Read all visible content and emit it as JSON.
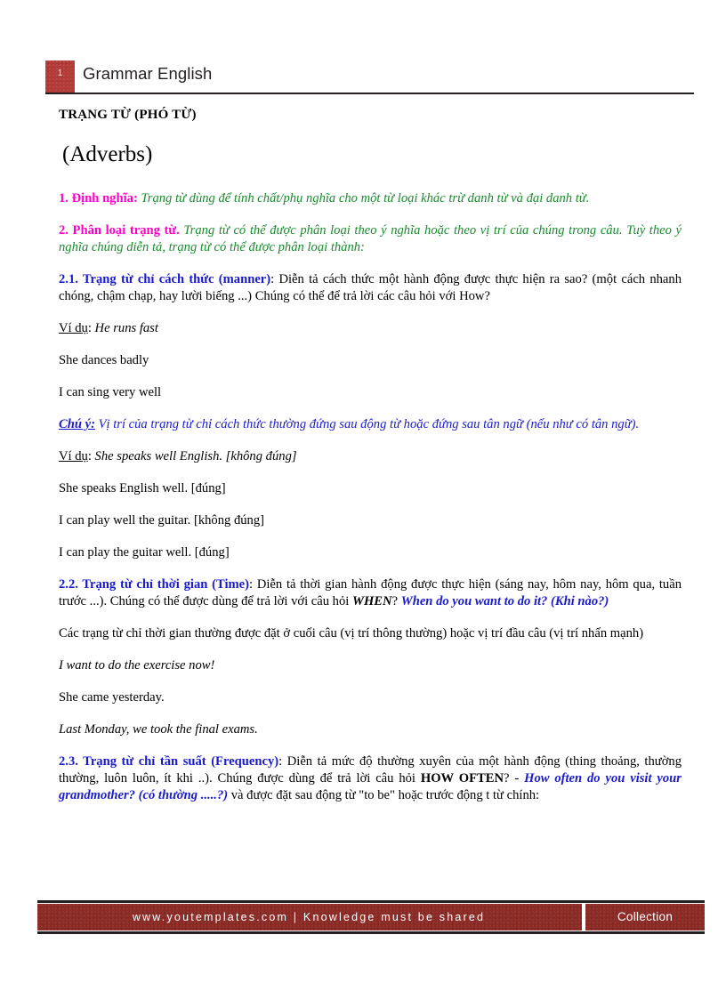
{
  "header": {
    "page_number": "1",
    "title": "Grammar English"
  },
  "document": {
    "heading_vi": "TRẠNG TỪ (PHÓ TỪ)",
    "heading_en": "(Adverbs)",
    "sections": {
      "definition": {
        "label": "1. Định nghĩa:",
        "text": " Trạng từ dùng để tính chất/phụ nghĩa cho một từ loại khác trừ danh từ và đại danh từ."
      },
      "classification": {
        "label": "2. Phân loại trạng từ.",
        "text": " Trạng từ có thể được phân loại theo ý nghĩa hoặc theo vị trí của chúng trong câu. Tuỳ theo ý nghĩa chúng diễn tả, trạng từ có thể được phân loại thành:"
      },
      "manner": {
        "label": "2.1. Trạng từ chỉ cách thức (manner)",
        "text": ": Diễn tả cách thức một hành động được thực hiện ra sao? (một cách nhanh chóng, chậm chạp, hay lười biếng ...) Chúng có thể để trả lời các câu hỏi với How?",
        "example_label": "Ví dụ",
        "example_colon": ": ",
        "example_first": "He runs fast",
        "examples": [
          "She dances badly",
          "I can sing very well"
        ],
        "note_label": "Chú ý:",
        "note_text": " Vị trí của trạng từ chỉ cách thức thường đứng sau động từ hoặc đứng sau tân ngữ (nếu như có tân ngữ).",
        "note_example_label": "Ví dụ",
        "note_example_colon": ": ",
        "note_example_first": "She speaks well English. [không đúng]",
        "note_examples": [
          "She speaks English well. [đúng]",
          "I can play well the guitar. [không đúng]",
          "I can play the guitar well. [đúng]"
        ]
      },
      "time": {
        "label": "2.2. Trạng từ chỉ thời gian (Time)",
        "text_part1": ": Diễn tả thời gian hành động được thực hiện (sáng nay, hôm nay, hôm qua, tuần trước ...). Chúng có thể được dùng để trả lời với câu hỏi ",
        "when_bold": "WHEN",
        "text_part2": "? ",
        "question_blue": "When do you want to do it? (Khi nào?)",
        "position_note": "Các trạng từ chỉ thời gian thường được đặt ở cuối câu (vị trí thông thường) hoặc vị trí đầu câu (vị trí nhấn mạnh)",
        "examples": [
          "I want to do the exercise now!",
          "She came yesterday.",
          "Last Monday, we took the final exams."
        ]
      },
      "frequency": {
        "label": "2.3. Trạng từ chỉ tần suất (Frequency)",
        "text_part1": ": Diễn tả mức độ thường xuyên của một hành động (thing thoảng, thường thường, luôn luôn, ít khi ..). Chúng được dùng để trả lời câu hỏi ",
        "how_often_bold": "HOW OFTEN",
        "text_part2": "? - ",
        "question_blue": "How often do you visit your grandmother? (có thường .....?)",
        "text_part3": " và được đặt sau động từ \"to be\" hoặc trước động t từ chính:"
      }
    }
  },
  "footer": {
    "main_text": "www.youtemplates.com | Knowledge must be shared",
    "collection_label": "Collection"
  },
  "colors": {
    "badge_red": "#b33b38",
    "footer_red": "#8c2b26",
    "magenta": "#ff00c8",
    "green": "#1a8a2e",
    "blue": "#1a1acd",
    "ink": "#231f20"
  }
}
